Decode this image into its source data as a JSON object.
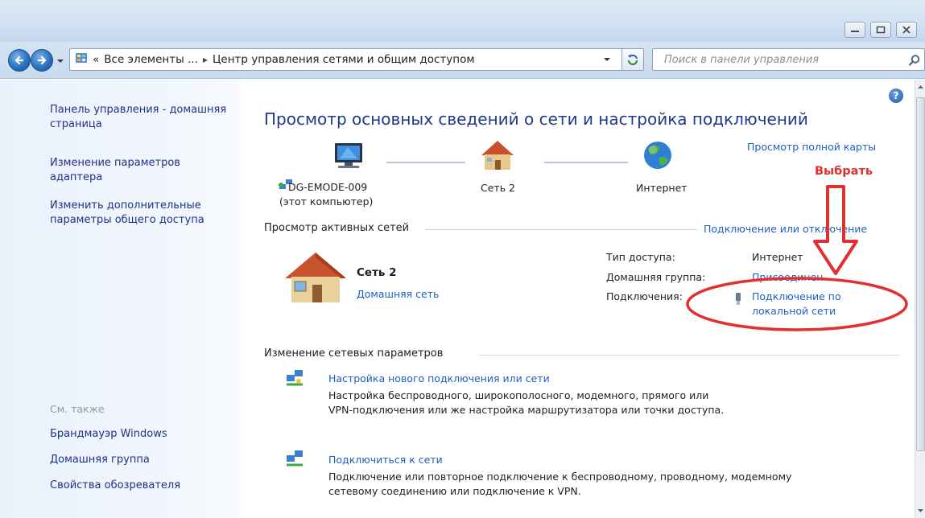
{
  "window": {
    "caption_buttons": [
      "minimize-icon",
      "maximize-icon",
      "close-icon"
    ]
  },
  "address_bar": {
    "overflow": "«",
    "crumb_1": "Все элементы ...",
    "separator": "▸",
    "crumb_2": "Центр управления сетями и общим доступом"
  },
  "search": {
    "placeholder": "Поиск в панели управления"
  },
  "left_pane": {
    "home_link": "Панель управления - домашняя страница",
    "adapter_link": "Изменение параметров адаптера",
    "sharing_link": "Изменить дополнительные параметры общего доступа",
    "see_also": "См. также",
    "see_also_links": [
      "Брандмауэр Windows",
      "Домашняя группа",
      "Свойства обозревателя"
    ]
  },
  "main": {
    "title": "Просмотр основных сведений о сети и настройка подключений",
    "full_map_link": "Просмотр полной карты",
    "map": {
      "computer_name": "DG-EMODE-009",
      "computer_sub": "(этот компьютер)",
      "network_name": "Сеть 2",
      "internet": "Интернет"
    },
    "active_networks": {
      "heading": "Просмотр активных сетей",
      "connect_link": "Подключение или отключение",
      "network_name": "Сеть 2",
      "network_type": "Домашняя сеть",
      "access_type_label": "Тип доступа:",
      "access_type_value": "Интернет",
      "homegroup_label": "Домашняя группа:",
      "homegroup_value": "Присоединен",
      "connections_label": "Подключения:",
      "connection_value_line1": "Подключение по",
      "connection_value_line2": "локальной сети"
    },
    "change_settings": {
      "heading": "Изменение сетевых параметров",
      "tasks": [
        {
          "link": "Настройка нового подключения или сети",
          "desc_line1": "Настройка беспроводного, широкополосного, модемного, прямого или",
          "desc_line2": "VPN-подключения или же настройка маршрутизатора или точки доступа."
        },
        {
          "link": "Подключиться к сети",
          "desc_line1": "Подключение или повторное подключение к беспроводному, проводному, модемному",
          "desc_line2": "сетевому соединению или подключение к VPN."
        }
      ]
    }
  },
  "annotation": {
    "label": "Выбрать",
    "color": "#e03030"
  },
  "colors": {
    "link": "#1f5fbf",
    "left_link": "#1e3287",
    "title": "#1e3a8a"
  }
}
